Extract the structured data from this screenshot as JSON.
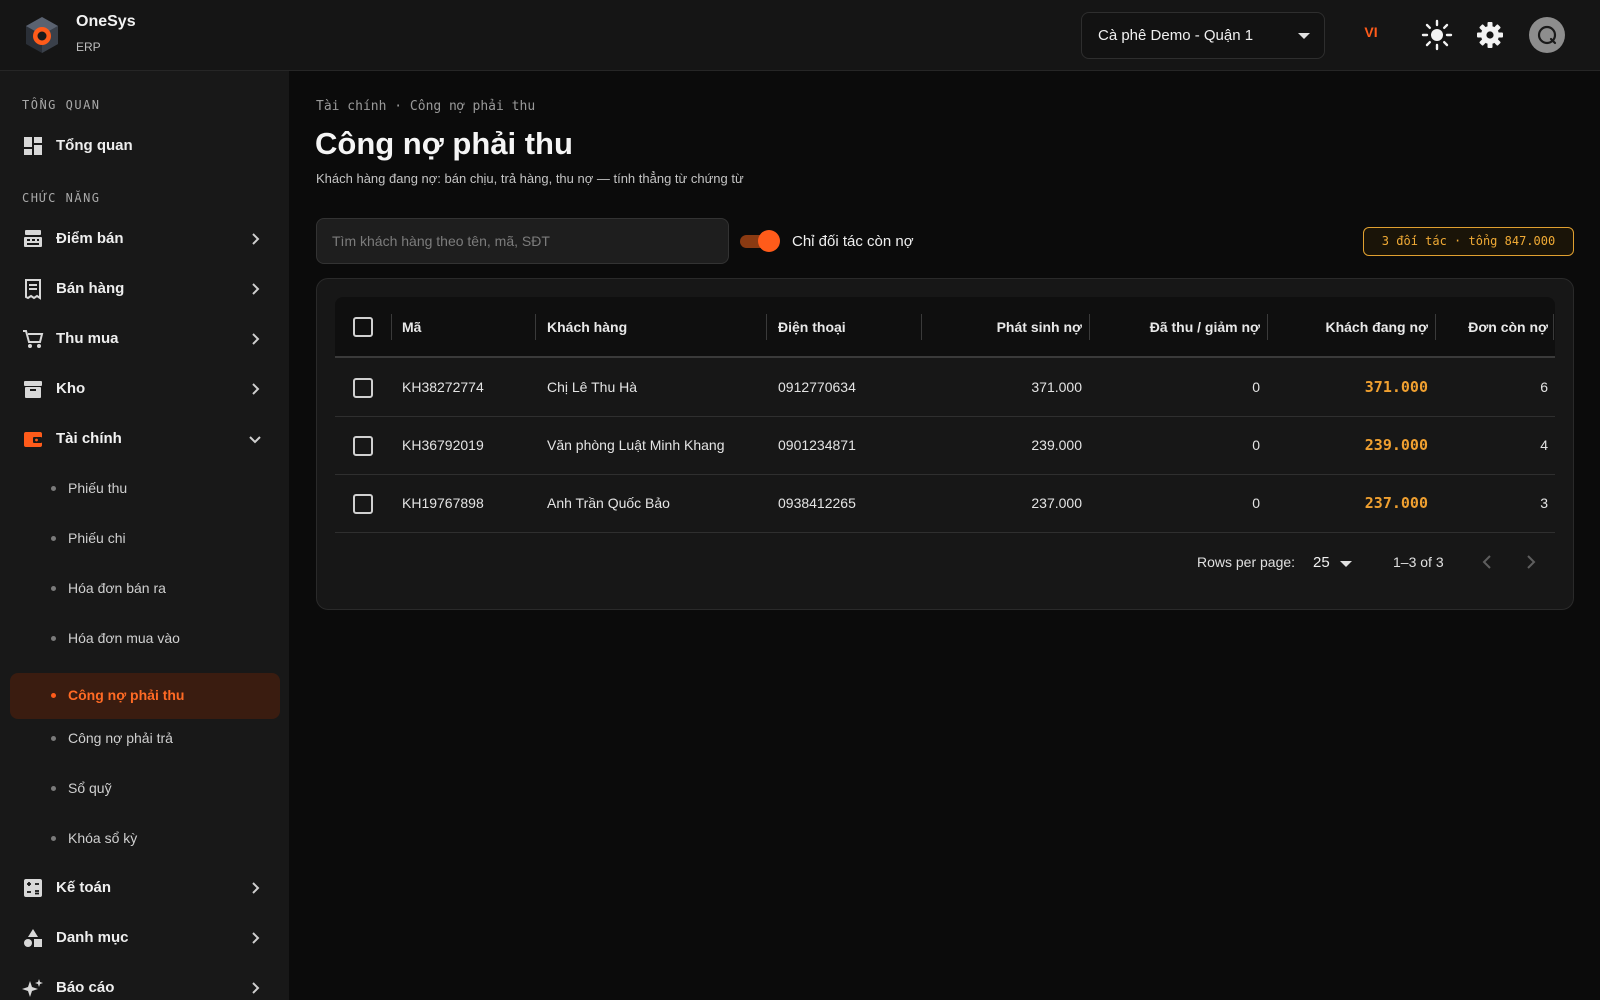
{
  "header": {
    "brand_name": "OneSys",
    "brand_sub": "ERP",
    "store_selected": "Cà phê Demo - Quận 1",
    "lang": "VI",
    "icons": [
      "logo-icon",
      "sun-icon",
      "gear-icon",
      "avatar"
    ]
  },
  "sidebar": {
    "section_overview": "TỔNG QUAN",
    "overview_item": "Tổng quan",
    "section_functions": "CHỨC NĂNG",
    "items": [
      {
        "label": "Điểm bán",
        "icon": "pos-icon"
      },
      {
        "label": "Bán hàng",
        "icon": "receipt-icon"
      },
      {
        "label": "Thu mua",
        "icon": "cart-icon"
      },
      {
        "label": "Kho",
        "icon": "archive-icon"
      },
      {
        "label": "Tài chính",
        "icon": "wallet-icon"
      }
    ],
    "finance_sub": [
      "Phiếu thu",
      "Phiếu chi",
      "Hóa đơn bán ra",
      "Hóa đơn mua vào",
      "Công nợ phải thu",
      "Công nợ phải trả",
      "Sổ quỹ",
      "Khóa sổ kỳ"
    ],
    "active_sub": "Công nợ phải thu",
    "items_after": [
      {
        "label": "Kế toán",
        "icon": "calculator-icon"
      },
      {
        "label": "Danh mục",
        "icon": "shapes-icon"
      },
      {
        "label": "Báo cáo",
        "icon": "sparkle-icon"
      }
    ]
  },
  "page": {
    "breadcrumb": "Tài chính · Công nợ phải thu",
    "title": "Công nợ phải thu",
    "subtitle": "Khách hàng đang nợ: bán chịu, trả hàng, thu nợ — tính thẳng từ chứng từ",
    "search_placeholder": "Tìm khách hàng theo tên, mã, SĐT",
    "toggle_label": "Chỉ đối tác còn nợ",
    "toggle_on": true,
    "summary_badge": "3 đối tác · tổng 847.000",
    "accent_color": "#ff5b1a",
    "amount_color": "#f0a030"
  },
  "table": {
    "columns": [
      "Mã",
      "Khách hàng",
      "Điện thoại",
      "Phát sinh nợ",
      "Đã thu / giảm nợ",
      "Khách đang nợ",
      "Đơn còn nợ"
    ],
    "rows": [
      {
        "code": "KH38272774",
        "customer": "Chị Lê Thu Hà",
        "phone": "0912770634",
        "incurred": "371.000",
        "collected": "0",
        "owing": "371.000",
        "orders": "6"
      },
      {
        "code": "KH36792019",
        "customer": "Văn phòng Luật Minh Khang",
        "phone": "0901234871",
        "incurred": "239.000",
        "collected": "0",
        "owing": "239.000",
        "orders": "4"
      },
      {
        "code": "KH19767898",
        "customer": "Anh Trần Quốc Bảo",
        "phone": "0938412265",
        "incurred": "237.000",
        "collected": "0",
        "owing": "237.000",
        "orders": "3"
      }
    ],
    "rows_per_page_label": "Rows per page:",
    "rows_per_page": "25",
    "range": "1–3 of 3"
  }
}
